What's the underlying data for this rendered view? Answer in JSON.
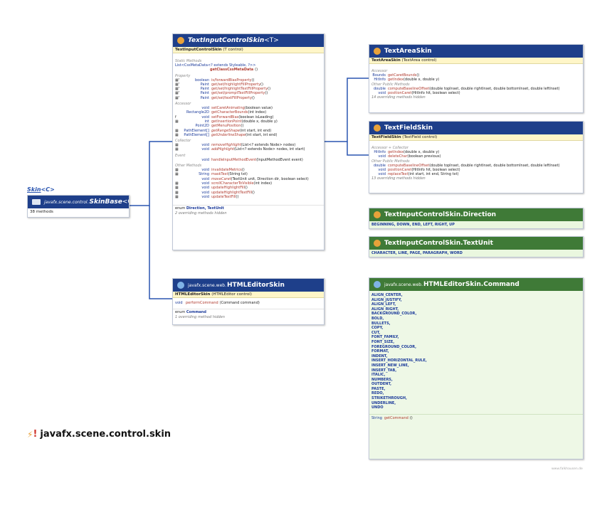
{
  "skin_label": "Skin",
  "skin_generic": "<C>",
  "skinbase": {
    "package": "javafx.scene.control.",
    "name": "SkinBase",
    "generic": " <C>",
    "methods": "38 methods"
  },
  "tic": {
    "title": "TextInputControlSkin",
    "generic": " <T>",
    "ctor": "TextInputControlSkin",
    "ctor_args": " (T control)",
    "sec_static": "Static Methods",
    "static_type": "List<CssMetaData<? extends Styleable, ?>>",
    "static_name": "getClassCssMetaData",
    "static_args": " ()",
    "sec_property": "Property",
    "properties": [
      {
        "mod": "▦ᶠ",
        "type": "boolean",
        "name": "is/forwardBiasProperty",
        "args": " ()"
      },
      {
        "mod": "▦ᶠ",
        "type": "Paint",
        "name": "get/set/highlightFillProperty",
        "args": " ()"
      },
      {
        "mod": "▦ᶠ",
        "type": "Paint",
        "name": "get/set/highlightTextFillProperty",
        "args": " ()"
      },
      {
        "mod": "▦ᶠ",
        "type": "Paint",
        "name": "get/set/promptTextFillProperty",
        "args": " ()"
      },
      {
        "mod": "▦ᶠ",
        "type": "Paint",
        "name": "get/set/textFillProperty",
        "args": " ()"
      }
    ],
    "sec_accessor": "Accessor",
    "accessors": [
      {
        "mod": "",
        "type": "void",
        "name": "setCaretAnimating",
        "args": " (boolean value)",
        "it": false
      },
      {
        "mod": "",
        "type": "Rectangle2D",
        "name": "getCharacterBounds",
        "args": " (int index)",
        "it": false
      },
      {
        "mod": "f",
        "type": "void",
        "name": "setForwardBias",
        "args": " (boolean isLeading)",
        "it": false
      },
      {
        "mod": "▦",
        "type": "int",
        "name": "getInsertionPoint",
        "args": " (double x, double y)",
        "it": false
      },
      {
        "mod": "",
        "type": "Point2D",
        "name": "getMenuPosition",
        "args": " ()",
        "it": false
      },
      {
        "mod": "▦",
        "type": "PathElement[]",
        "name": "getRangeShape",
        "args": " (int start, int end)",
        "it": true
      },
      {
        "mod": "▦",
        "type": "PathElement[]",
        "name": "getUnderlineShape",
        "args": " (int start, int end)",
        "it": true
      }
    ],
    "sec_collector": "Collector",
    "collectors": [
      {
        "mod": "▦",
        "type": "void",
        "name": "removeHighlight",
        "args": " (List<? extends Node> nodes)",
        "it": true
      },
      {
        "mod": "▦",
        "type": "void",
        "name": "addHighlight",
        "args": " (List<? extends Node> nodes, int start)",
        "it": true
      }
    ],
    "sec_event": "Event",
    "events": [
      {
        "mod": "",
        "type": "void",
        "name": "handleInputMethodEvent",
        "args": " (InputMethodEvent event)",
        "it": false
      }
    ],
    "sec_other": "Other Methods",
    "others": [
      {
        "mod": "▦",
        "type": "void",
        "name": "invalidateMetrics",
        "args": " ()",
        "it": false
      },
      {
        "mod": "▦",
        "type": "String",
        "name": "maskText",
        "args": " (String txt)",
        "it": false
      },
      {
        "mod": "",
        "type": "void",
        "name": "moveCaret",
        "args": " (TextUnit unit, Direction dir, boolean select)",
        "it": true
      },
      {
        "mod": "▦",
        "type": "void",
        "name": "scrollCharacterToVisible",
        "args": " (int index)",
        "it": false
      },
      {
        "mod": "▦",
        "type": "void",
        "name": "updateHighlightFill",
        "args": " ()",
        "it": false
      },
      {
        "mod": "▦",
        "type": "void",
        "name": "updateHighlightTextFill",
        "args": " ()",
        "it": false
      },
      {
        "mod": "▦",
        "type": "void",
        "name": "updateTextFill",
        "args": " ()",
        "it": false
      }
    ],
    "enum_label": "enum",
    "enum_values": "Direction, TextUnit",
    "hidden": "2 overriding methods hidden"
  },
  "html": {
    "package": "javafx.scene.web.",
    "title": "HTMLEditorSkin",
    "ctor": "HTMLEditorSkin",
    "ctor_args": " (HTMLEditor control)",
    "method_type": "void",
    "method_name": "performCommand",
    "method_args": " (Command command)",
    "enum_label": "enum",
    "enum_values": "Command",
    "hidden": "1 overriding method hidden"
  },
  "textarea": {
    "title": "TextAreaSkin",
    "ctor": "TextAreaSkin",
    "ctor_args": " (TextArea control)",
    "sec_accessor": "Accessor",
    "accessors": [
      {
        "type": "Bounds",
        "name": "getCaretBounds",
        "args": " ()"
      },
      {
        "type": "HitInfo",
        "name": "getIndex",
        "args": " (double x, double y)"
      }
    ],
    "sec_other": "Other Public Methods",
    "others": [
      {
        "type": "double",
        "name": "computeBaselineOffset",
        "args": " (double topInset, double rightInset, double bottomInset, double leftInset)"
      },
      {
        "type": "void",
        "name": "positionCaret",
        "args": " (HitInfo hit, boolean select)"
      }
    ],
    "hidden": "14 overriding methods hidden"
  },
  "textfield": {
    "title": "TextFieldSkin",
    "ctor": "TextFieldSkin",
    "ctor_args": " (TextField control)",
    "sec_accessor": "Accessor + Collector",
    "accessors": [
      {
        "type": "HitInfo",
        "name": "getIndex",
        "args": " (double x, double y)"
      },
      {
        "type": "void",
        "name": "deleteChar",
        "args": " (boolean previous)"
      }
    ],
    "sec_other": "Other Public Methods",
    "others": [
      {
        "type": "double",
        "name": "computeBaselineOffset",
        "args": " (double topInset, double rightInset, double bottomInset, double leftInset)"
      },
      {
        "type": "void",
        "name": "positionCaret",
        "args": " (HitInfo hit, boolean select)"
      },
      {
        "type": "void",
        "name": "replaceText",
        "args": " (int start, int end, String txt)"
      }
    ],
    "hidden": "13 overriding methods hidden"
  },
  "direction": {
    "title": "TextInputControlSkin.Direction",
    "constants": "BEGINNING, DOWN, END, LEFT, RIGHT, UP"
  },
  "textunit": {
    "title": "TextInputControlSkin.TextUnit",
    "constants": "CHARACTER, LINE, PAGE, PARAGRAPH, WORD"
  },
  "command": {
    "package": "javafx.scene.web.",
    "title": "HTMLEditorSkin.Command",
    "constants": [
      "ALIGN_CENTER,",
      "ALIGN_JUSTIFY,",
      "ALIGN_LEFT,",
      "ALIGN_RIGHT,",
      "BACKGROUND_COLOR,",
      "BOLD,",
      "BULLETS,",
      "COPY,",
      "CUT,",
      "FONT_FAMILY,",
      "FONT_SIZE,",
      "FOREGROUND_COLOR,",
      "FORMAT,",
      "INDENT,",
      "INSERT_HORIZONTAL_RULE,",
      "INSERT_NEW_LINE,",
      "INSERT_TAB,",
      "ITALIC,",
      "NUMBERS,",
      "OUTDENT,",
      "PASTE,",
      "REDO,",
      "STRIKETHROUGH,",
      "UNDERLINE,",
      "UNDO"
    ],
    "method_type": "String",
    "method_name": "getCommand",
    "method_args": " ()"
  },
  "package_title": "javafx.scene.control.skin",
  "watermark": "www.falkhausen.de",
  "colors": {
    "header_blue": "#1e3f8a",
    "header_green": "#3f7a37",
    "connector": "#2a55b0"
  }
}
